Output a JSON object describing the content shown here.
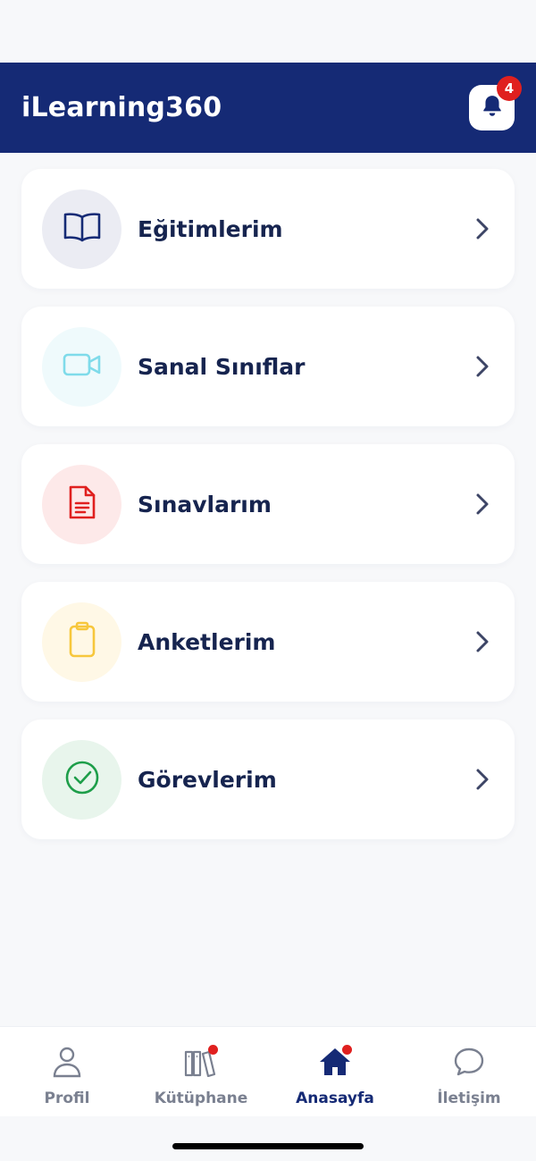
{
  "header": {
    "title": "iLearning360",
    "notification_count": "4"
  },
  "menu": {
    "items": [
      {
        "label": "Eğitimlerim",
        "icon": "book-open-icon",
        "color": "#152a75",
        "bg": "#ebecf3"
      },
      {
        "label": "Sanal Sınıflar",
        "icon": "video-camera-icon",
        "color": "#7fdbea",
        "bg": "#effafc"
      },
      {
        "label": "Sınavlarım",
        "icon": "document-icon",
        "color": "#e0201f",
        "bg": "#fde9e9"
      },
      {
        "label": "Anketlerim",
        "icon": "clipboard-icon",
        "color": "#f7c73c",
        "bg": "#fff8e6"
      },
      {
        "label": "Görevlerim",
        "icon": "check-circle-icon",
        "color": "#1e9e4a",
        "bg": "#e8f5ec"
      }
    ]
  },
  "tabbar": {
    "tabs": [
      {
        "label": "Profil",
        "icon": "user-icon"
      },
      {
        "label": "Kütüphane",
        "icon": "library-icon"
      },
      {
        "label": "Anasayfa",
        "icon": "home-icon",
        "active": true
      },
      {
        "label": "İletişim",
        "icon": "chat-icon"
      }
    ]
  },
  "colors": {
    "brand": "#152a75",
    "badge": "#e0201f",
    "text": "#16244f",
    "muted": "#7a8090"
  }
}
